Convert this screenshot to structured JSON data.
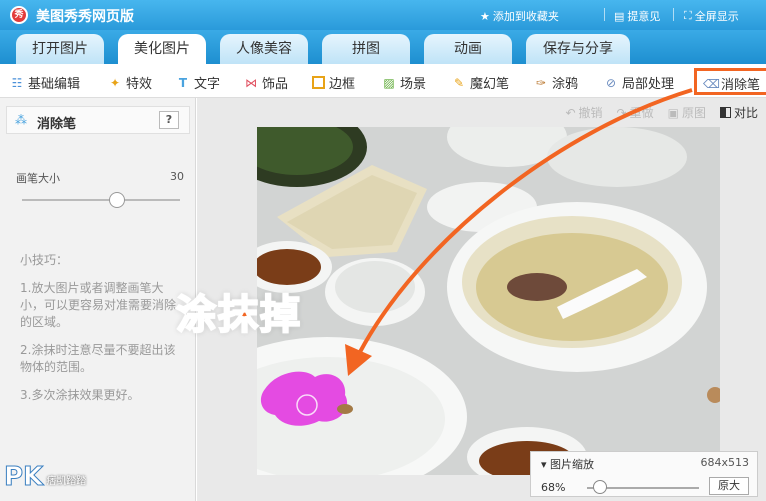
{
  "app": {
    "logo_text": "秀",
    "title": "美图秀秀网页版",
    "links": {
      "favorite": "添加到收藏夹",
      "feedback": "提意见",
      "fullscreen": "全屏显示"
    }
  },
  "tabs": [
    "打开图片",
    "美化图片",
    "人像美容",
    "拼图",
    "动画",
    "保存与分享"
  ],
  "active_tab": "美化图片",
  "tools": [
    "基础编辑",
    "特效",
    "文字",
    "饰品",
    "边框",
    "场景",
    "魔幻笔",
    "涂鸦",
    "局部处理",
    "消除笔"
  ],
  "highlighted_tool": "消除笔",
  "panel": {
    "title": "消除笔",
    "help": "?",
    "brush_label": "画笔大小",
    "brush_value": "30",
    "brush_level_fraction": 0.6,
    "tips": [
      "小技巧：",
      "1.放大图片或者调整画笔大小，可以更容易对准需要消除的区域。",
      "2.涂抹时注意尽量不要超出该物体的范围。",
      "3.多次涂抹效果更好。"
    ]
  },
  "edit_toolbar": {
    "undo": "撤销",
    "redo": "重做",
    "original": "原图",
    "contrast": "对比"
  },
  "zoom": {
    "title": "图片缩放",
    "dims": "684x513",
    "percent": "68%",
    "original_size": "原大"
  },
  "annotation": {
    "label": "涂抹掉",
    "color": "#f26522"
  },
  "watermark": {
    "brand": "PK",
    "name": "痞凱踏踏"
  }
}
